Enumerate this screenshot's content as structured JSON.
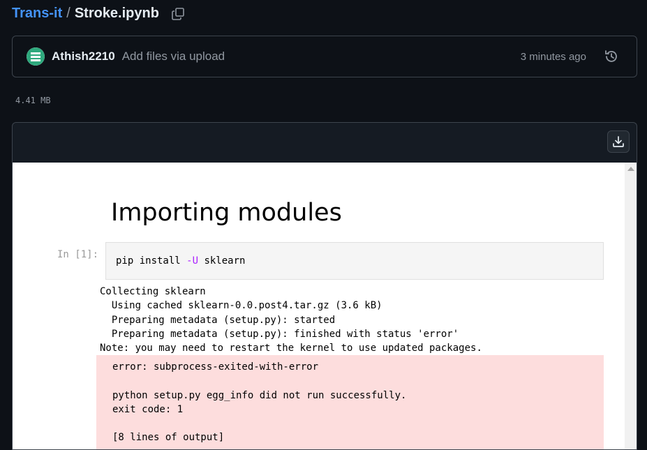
{
  "breadcrumb": {
    "repo": "Trans-it",
    "separator": "/",
    "file": "Stroke.ipynb"
  },
  "commit": {
    "author": "Athish2210",
    "message": "Add files via upload",
    "time": "3 minutes ago"
  },
  "file": {
    "size": "4.41 MB"
  },
  "notebook": {
    "heading": "Importing modules",
    "prompt": "In [1]:",
    "code": {
      "cmd": "pip install ",
      "flag": "-U",
      "arg": " sklearn"
    },
    "stdout_lines": [
      "Collecting sklearn",
      "  Using cached sklearn-0.0.post4.tar.gz (3.6 kB)",
      "  Preparing metadata (setup.py): started",
      "  Preparing metadata (setup.py): finished with status 'error'",
      "Note: you may need to restart the kernel to use updated packages."
    ],
    "stderr_lines": [
      "error: subprocess-exited-with-error",
      "",
      "python setup.py egg_info did not run successfully.",
      "exit code: 1",
      "",
      "[8 lines of output]"
    ]
  },
  "icons": {
    "copy": "copy-icon",
    "history": "history-icon",
    "download": "download-icon",
    "avatar": "identicon"
  },
  "colors": {
    "link": "#4493f8",
    "background": "#0d1117",
    "error_bg": "#fddddd"
  }
}
